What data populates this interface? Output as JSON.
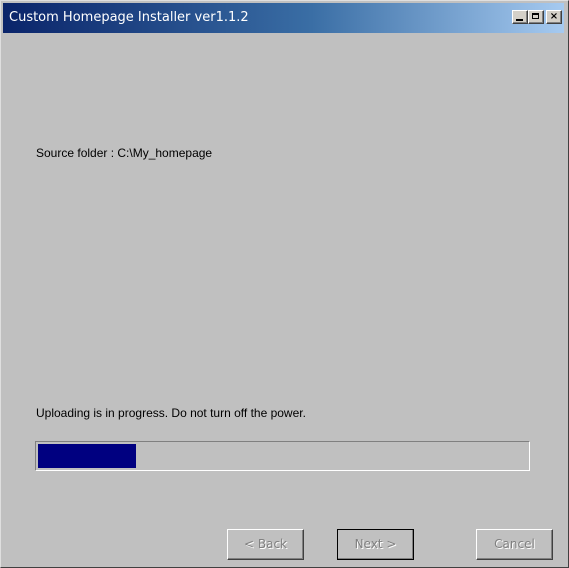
{
  "window": {
    "title": "Custom Homepage Installer ver1.1.2",
    "controls": {
      "minimize": "_",
      "maximize": "□",
      "close": "×"
    }
  },
  "main": {
    "source_folder_text": "Source folder : C:\\My_homepage",
    "status_text": "Uploading is in progress. Do not turn off the power.",
    "progress_fraction": 0.2
  },
  "buttons": {
    "back": "< Back",
    "next": "Next >",
    "cancel": "Cancel"
  },
  "colors": {
    "titlebar_start": "#0a246a",
    "progress_fill": "#000080",
    "face": "#c0c0c0"
  }
}
